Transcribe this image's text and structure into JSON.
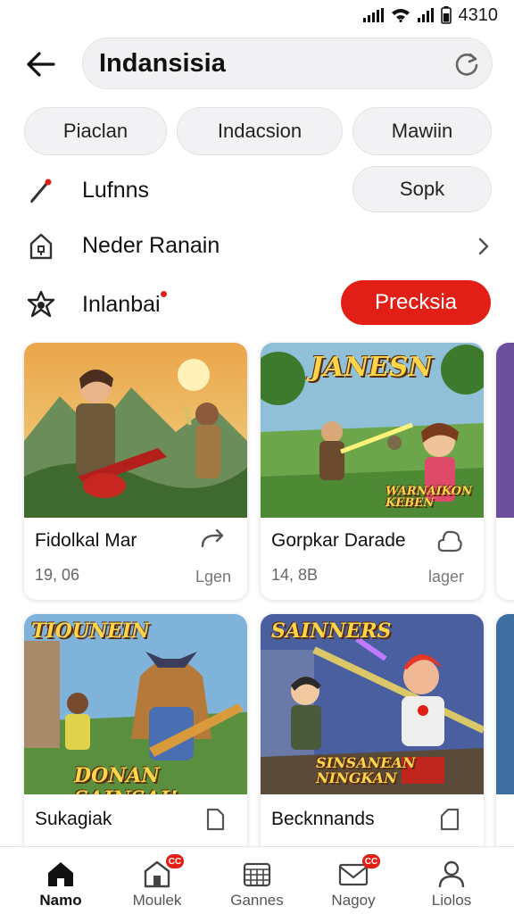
{
  "status_bar": {
    "time": "4310"
  },
  "search": {
    "query": "Indansisia"
  },
  "chips": [
    {
      "label": "Piaclan"
    },
    {
      "label": "Indacsion"
    },
    {
      "label": "Mawiin"
    }
  ],
  "rows": {
    "lufnns": {
      "label": "Lufnns",
      "button": "Sopk",
      "icon": "pencil-icon"
    },
    "neder": {
      "label": "Neder Ranain",
      "icon": "home-lock-icon"
    },
    "inlanbai": {
      "label": "Inlanbai",
      "button": "Precksia",
      "icon": "star-badge-icon"
    }
  },
  "cards": [
    {
      "title": "Fidolkal Mar",
      "meta": "19, 06",
      "tag": "Lgen",
      "action_icon": "share-arrow-icon"
    },
    {
      "title": "Gorpkar Darade",
      "meta": "14, 8B",
      "tag": "lager",
      "action_icon": "cloud-icon",
      "art_title": "JANESN",
      "art_subtitle": "WARNAIKON KEBEN"
    },
    {
      "title": "Sukagiak",
      "action_icon": "bookmark-icon",
      "art_title": "TIOUNEIN",
      "art_subtitle": "DONAN SAINSAI!"
    },
    {
      "title": "Becknnands",
      "action_icon": "tag-icon",
      "art_title": "SAINNERS",
      "art_subtitle": "SINSANEAN NINGKAN"
    }
  ],
  "nav": [
    {
      "label": "Namo",
      "icon": "home-icon",
      "active": true
    },
    {
      "label": "Moulek",
      "icon": "store-icon",
      "badge": "CC"
    },
    {
      "label": "Gannes",
      "icon": "grid-icon"
    },
    {
      "label": "Nagoy",
      "icon": "mail-icon",
      "badge": "CC"
    },
    {
      "label": "Liolos",
      "icon": "person-icon"
    }
  ],
  "colors": {
    "accent": "#e21f16",
    "chip_bg": "#f2f2f4",
    "text": "#111111",
    "muted": "#666666"
  }
}
